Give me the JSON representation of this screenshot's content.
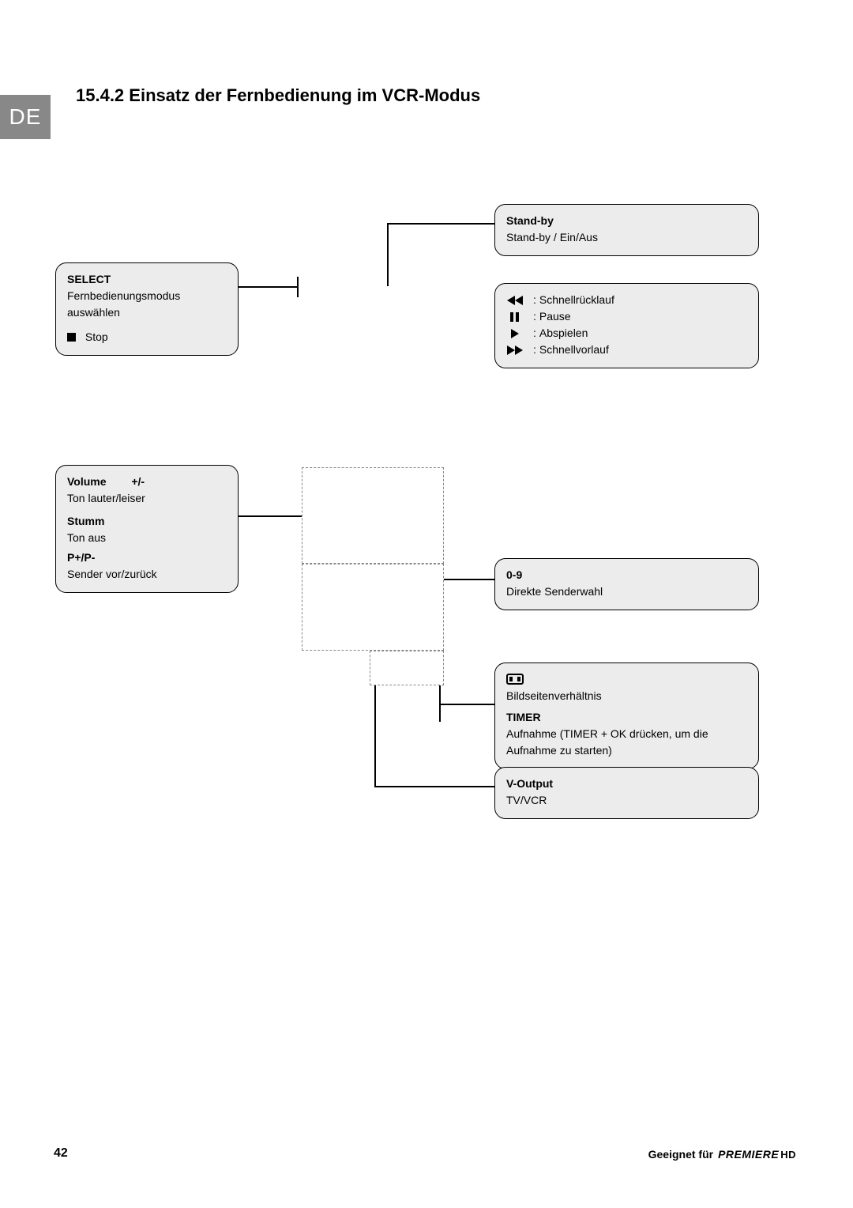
{
  "lang_tab": "DE",
  "heading": "15.4.2  Einsatz der Fernbedienung im VCR-Modus",
  "standby": {
    "title": "Stand-by",
    "desc": "Stand-by / Ein/Aus"
  },
  "select": {
    "title": "SELECT",
    "desc": "Fernbedienungsmodus auswählen",
    "stop": "Stop"
  },
  "transport": {
    "rewind": "Schnellrücklauf",
    "pause": "Pause",
    "play": "Abspielen",
    "ffwd": "Schnellvorlauf"
  },
  "volume_box": {
    "volume_title": "Volume",
    "volume_sign": "+/-",
    "volume_desc": "Ton lauter/leiser",
    "mute_title": "Stumm",
    "mute_desc": "Ton aus",
    "prog_title": "P+/P-",
    "prog_desc": "Sender vor/zurück"
  },
  "digits": {
    "title": "0-9",
    "desc": "Direkte Senderwahl"
  },
  "aspect_timer": {
    "aspect_desc": "Bildseitenverhältnis",
    "timer_title": "TIMER",
    "timer_desc": "Aufnahme (TIMER + OK drücken, um die Aufnahme zu starten)"
  },
  "voutput": {
    "title": "V-Output",
    "desc": "TV/VCR"
  },
  "footer": {
    "page": "42",
    "right_label": "Geeignet für",
    "brand": "PREMIERE",
    "brand_suffix": "HD"
  }
}
